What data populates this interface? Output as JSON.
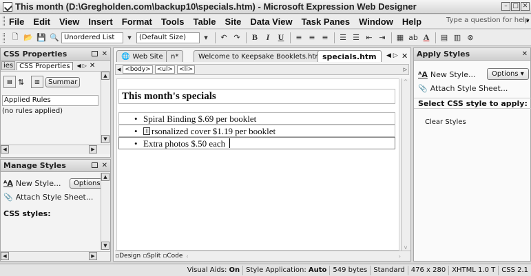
{
  "window": {
    "title": "This month (D:\\Gregholden.com\\backup10\\specials.htm) - Microsoft Expression Web Designer"
  },
  "menu": {
    "items": [
      {
        "label": "File"
      },
      {
        "label": "Edit"
      },
      {
        "label": "View"
      },
      {
        "label": "Insert"
      },
      {
        "label": "Format"
      },
      {
        "label": "Tools"
      },
      {
        "label": "Table"
      },
      {
        "label": "Site"
      },
      {
        "label": "Data View"
      },
      {
        "label": "Task Panes"
      },
      {
        "label": "Window"
      },
      {
        "label": "Help"
      }
    ],
    "help_placeholder": "Type a question for help"
  },
  "toolbar": {
    "style_combo": "Unordered List",
    "size_combo": "(Default Size)"
  },
  "css_properties": {
    "title": "CSS Properties",
    "tab_partial": "ies",
    "tab_active": "CSS Properties",
    "summary_button": "Summar",
    "applied_rules_label": "Applied Rules",
    "no_rules": "(no rules applied)"
  },
  "manage_styles": {
    "title": "Manage Styles",
    "new_style": "New Style...",
    "options": "Options",
    "attach": "Attach Style Sheet...",
    "css_styles_label": "CSS styles:"
  },
  "editor": {
    "tabs": [
      {
        "label": "Web Site"
      },
      {
        "label": "n*"
      },
      {
        "label": "Welcome to Keepsake Booklets.htm"
      },
      {
        "label": "specials.htm"
      }
    ],
    "breadcrumb": [
      "<body>",
      "<ul>",
      "<li>"
    ],
    "heading": "This month's specials",
    "list_items": [
      "Spiral Binding $.69 per booklet",
      "rsonalized cover $1.19 per booklet",
      "Extra photos $.50 each"
    ],
    "view_tabs": [
      {
        "label": "Design"
      },
      {
        "label": "Split"
      },
      {
        "label": "Code"
      }
    ]
  },
  "apply_styles": {
    "title": "Apply Styles",
    "new_style": "New Style...",
    "options": "Options",
    "attach": "Attach Style Sheet...",
    "select_label": "Select CSS style to apply:",
    "clear_styles": "Clear Styles"
  },
  "statusbar": {
    "visual_aids_label": "Visual Aids:",
    "visual_aids_value": "On",
    "style_app_label": "Style Application:",
    "style_app_value": "Auto",
    "size": "549 bytes",
    "mode": "Standard",
    "dimensions": "476 x 280",
    "doctype": "XHTML 1.0 T",
    "css": "CSS 2.1"
  },
  "colors": {
    "selection_box": "#7a7a7a",
    "hatch": "#e9e9e9"
  }
}
